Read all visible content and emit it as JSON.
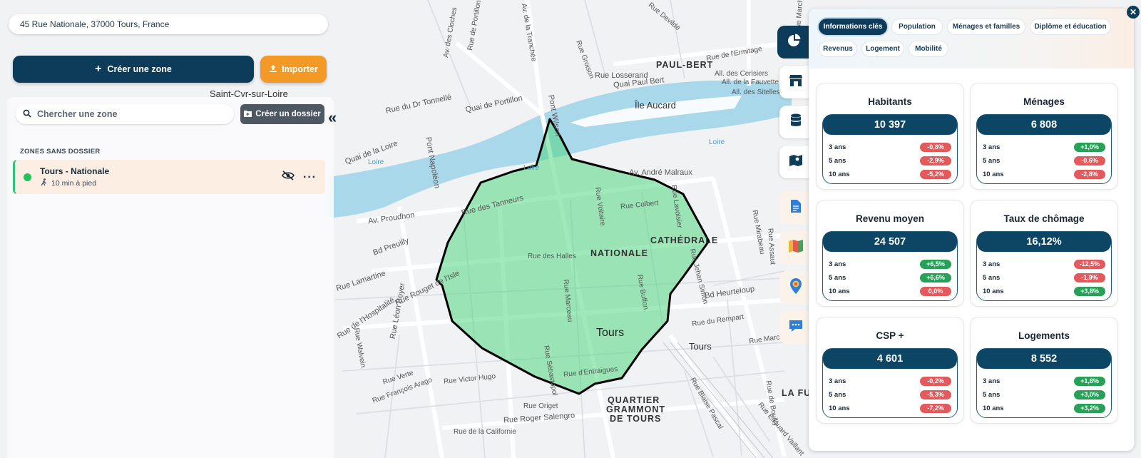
{
  "address": "45 Rue Nationale, 37000 Tours, France",
  "actions": {
    "create_zone": "Créer une zone",
    "import": "Importer"
  },
  "zones_panel": {
    "search_placeholder": "Chercher une zone",
    "create_folder": "Créer un dossier",
    "section_title": "ZONES SANS DOSSIER",
    "zones": [
      {
        "name": "Tours - Nationale",
        "subtitle": "10 min à pied",
        "status_color": "#1fc45b"
      }
    ],
    "collapse_icon": "«"
  },
  "toolbar_icons": [
    "pie-chart-icon",
    "store-icon",
    "database-icon",
    "map-pin-icon",
    "document-icon",
    "map-color-icon",
    "location-report-icon",
    "chat-icon"
  ],
  "tabs": [
    {
      "label": "Informations clés",
      "active": true
    },
    {
      "label": "Population",
      "active": false
    },
    {
      "label": "Ménages et familles",
      "active": false
    },
    {
      "label": "Diplôme et éducation",
      "active": false
    },
    {
      "label": "Revenus",
      "active": false
    },
    {
      "label": "Logement",
      "active": false
    },
    {
      "label": "Mobilité",
      "active": false
    }
  ],
  "cards": [
    {
      "title": "Habitants",
      "value": "10 397",
      "rows": [
        {
          "label": "3 ans",
          "value": "-0,8%",
          "trend": "neg"
        },
        {
          "label": "5 ans",
          "value": "-2,9%",
          "trend": "neg"
        },
        {
          "label": "10 ans",
          "value": "-5,2%",
          "trend": "neg"
        }
      ]
    },
    {
      "title": "Ménages",
      "value": "6 808",
      "rows": [
        {
          "label": "3 ans",
          "value": "+1,0%",
          "trend": "pos"
        },
        {
          "label": "5 ans",
          "value": "-0,6%",
          "trend": "neg"
        },
        {
          "label": "10 ans",
          "value": "-2,8%",
          "trend": "neg"
        }
      ]
    },
    {
      "title": "Revenu moyen",
      "value": "24 507",
      "rows": [
        {
          "label": "3 ans",
          "value": "+6,5%",
          "trend": "pos"
        },
        {
          "label": "5 ans",
          "value": "+6,6%",
          "trend": "pos"
        },
        {
          "label": "10 ans",
          "value": "0,0%",
          "trend": "neg"
        }
      ]
    },
    {
      "title": "Taux de chômage",
      "value": "16,12%",
      "rows": [
        {
          "label": "3 ans",
          "value": "-12,5%",
          "trend": "neg"
        },
        {
          "label": "5 ans",
          "value": "-1,9%",
          "trend": "neg"
        },
        {
          "label": "10 ans",
          "value": "+3,8%",
          "trend": "pos"
        }
      ]
    },
    {
      "title": "CSP +",
      "value": "4 601",
      "rows": [
        {
          "label": "3 ans",
          "value": "-0,2%",
          "trend": "neg"
        },
        {
          "label": "5 ans",
          "value": "-5,3%",
          "trend": "neg"
        },
        {
          "label": "10 ans",
          "value": "-7,2%",
          "trend": "neg"
        }
      ]
    },
    {
      "title": "Logements",
      "value": "8 552",
      "rows": [
        {
          "label": "3 ans",
          "value": "+1,8%",
          "trend": "pos"
        },
        {
          "label": "5 ans",
          "value": "+3,0%",
          "trend": "pos"
        },
        {
          "label": "10 ans",
          "value": "+3,2%",
          "trend": "pos"
        }
      ]
    }
  ],
  "map_labels": {
    "place_saint_cyr": "Saint-Cyr-sur-Loire",
    "place_paul_bert": "PAUL-BERT",
    "place_ile_aucard": "Île Aucard",
    "place_nationale": "NATIONALE",
    "place_cathedrale": "CATHÉDRALE",
    "place_tours": "Tours",
    "place_gare_tours": "Tours",
    "place_grammont_1": "QUARTIER",
    "place_grammont_2": "GRAMMONT",
    "place_grammont_3": "DE TOURS",
    "place_la_fuy": "LA FUY",
    "water_loire_1": "Loire",
    "water_loire_2": "Loire",
    "water_loire_3": "Loire",
    "street_quai_portillon": "Quai de Portillon",
    "street_quai_paul_bert": "Quai Paul Bert",
    "street_rue_losserand": "Rue Losserand",
    "street_rue_tonnelle": "Rue du Dr Tonnellé",
    "street_quai_loire": "Quai de la Loire",
    "street_pont_napoleon": "Pont Napoléon",
    "street_pont_wilson": "Pont Wilson",
    "street_av_malraux": "Av. André Malraux",
    "street_rue_tanneurs": "Rue des Tanneurs",
    "street_av_proudhon": "Av. Proudhon",
    "street_bd_preuilly": "Bd Preuilly",
    "street_rue_halles": "Rue des Halles",
    "street_rue_colbert": "Rue Colbert",
    "street_rue_voltaire": "Rue Voltaire",
    "street_rue_lavoisier": "Rue Lavoisier",
    "street_rue_lamartine": "Rue Lamartine",
    "street_rue_rouget": "Rue Rouget de l'Isle",
    "street_rue_hospitalite": "Rue de l'Hospitalité",
    "street_rue_leon_boyer": "Rue Léon Boyer",
    "street_rue_marceau": "Rue Marceau",
    "street_rue_buffon": "Rue Buffon",
    "street_bd_heurteloup": "Bd Heurteloup",
    "street_rue_rempart": "Rue du Rempart",
    "street_rue_entraigues": "Rue d'Entraigues",
    "street_rue_sebastopol": "Rue Sébastopol",
    "street_rue_victor_hugo": "Rue Victor Hugo",
    "street_rue_origet": "Rue Origet",
    "street_rue_salengro": "Rue Roger Salengro",
    "street_rue_californie": "Rue de la Californie",
    "street_rue_ermitage": "Rue de l'Ermitage",
    "street_rue_devilde": "Rue Devildé",
    "street_rue_groison": "Rue Groison",
    "street_all_cerisiers": "All. des Cerisiers",
    "street_all_fauvette": "All. de la Fauvette",
    "street_all_sitelles": "All. des Sitelles",
    "street_av_cloches": "Av. des Cloches",
    "street_rue_portillon": "Rue de Portillon",
    "street_av_tranchee": "Av. de la Tranchée",
    "street_rue_mirabeau": "Rue Mirabeau",
    "street_rue_jehan_simon": "Rue Jehan Simon",
    "street_rue_marcel_tribut": "Rue Marcel Tribut",
    "street_rue_edouard_vaillant": "Rue Édouard Vaillant",
    "street_rue_blaise_pascal": "Rue Blaise Pascal",
    "street_rue_verte": "Rue Verte",
    "street_rue_francois_arago": "Rue François Arago",
    "street_rue_walvein": "Rue Walvein",
    "street_rue_assaut": "Rue Assaut",
    "street_rue_bouilly": "Rue de Bouilly",
    "street_rue_marche": "Rue Marché"
  }
}
